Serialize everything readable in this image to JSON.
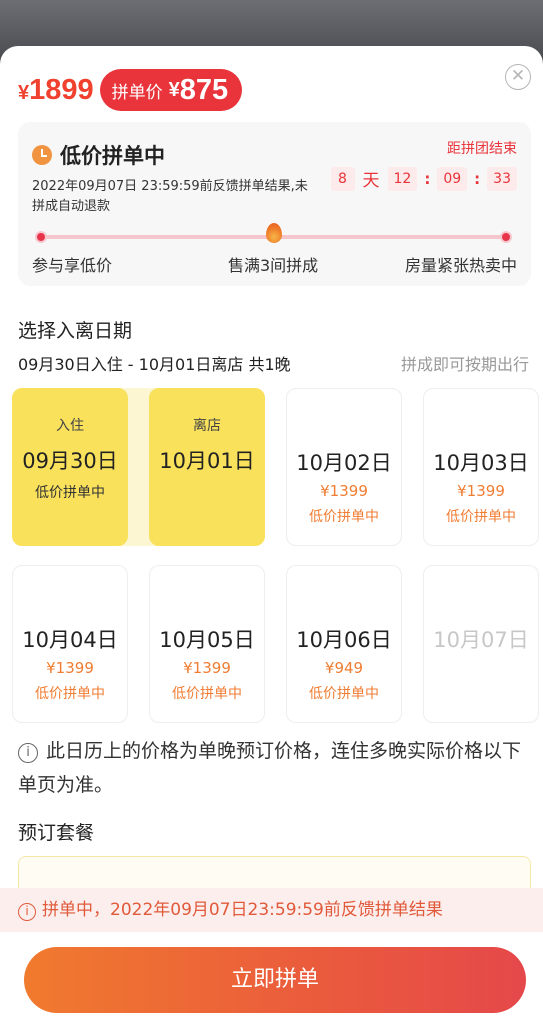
{
  "header": {
    "original_currency": "¥",
    "original_price": "1899",
    "group_label": "拼单价",
    "group_currency": "¥",
    "group_price": "875",
    "close_icon": "close-icon"
  },
  "group_status": {
    "title": "低价拼单中",
    "deadline_label": "距拼团结束",
    "description": "2022年09月07日 23:59:59前反馈拼单结果,未拼成自动退款",
    "countdown": {
      "days": "8",
      "day_unit": "天",
      "hours": "12",
      "minutes": "09",
      "seconds": "33",
      "separator": ":"
    },
    "stages": [
      "参与享低价",
      "售满3间拼成",
      "房量紧张热卖中"
    ]
  },
  "date_picker": {
    "title": "选择入离日期",
    "summary": "09月30日入住 - 10月01日离店 共1晚",
    "hint": "拼成即可按期出行",
    "days": [
      {
        "tag": "入住",
        "date": "09月30日",
        "price": "",
        "status": "低价拼单中",
        "state": "selected"
      },
      {
        "tag": "离店",
        "date": "10月01日",
        "price": "",
        "status": "",
        "state": "selected"
      },
      {
        "tag": "",
        "date": "10月02日",
        "price": "¥1399",
        "status": "低价拼单中",
        "state": "available"
      },
      {
        "tag": "",
        "date": "10月03日",
        "price": "¥1399",
        "status": "低价拼单中",
        "state": "available"
      },
      {
        "tag": "",
        "date": "10月04日",
        "price": "¥1399",
        "status": "低价拼单中",
        "state": "available"
      },
      {
        "tag": "",
        "date": "10月05日",
        "price": "¥1399",
        "status": "低价拼单中",
        "state": "available"
      },
      {
        "tag": "",
        "date": "10月06日",
        "price": "¥949",
        "status": "低价拼单中",
        "state": "available"
      },
      {
        "tag": "",
        "date": "10月07日",
        "price": "",
        "status": "",
        "state": "disabled"
      }
    ]
  },
  "note": {
    "icon": "i",
    "text": "此日历上的价格为单晚预订价格，连住多晚实际价格以下单页为准。"
  },
  "package": {
    "title": "预订套餐"
  },
  "banner": {
    "icon": "i",
    "text": "拼单中，2022年09月07日23:59:59前反馈拼单结果"
  },
  "cta": {
    "label": "立即拼单"
  }
}
